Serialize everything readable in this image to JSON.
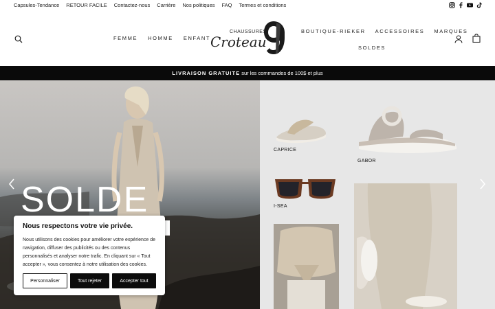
{
  "topbar": {
    "links": [
      "Capsules-Tendance",
      "RETOUR FACILE",
      "Contactez-nous",
      "Carrière",
      "Nos politiques",
      "FAQ",
      "Termes et conditions"
    ],
    "social_icons": [
      "instagram-icon",
      "facebook-icon",
      "youtube-icon",
      "tiktok-icon"
    ]
  },
  "header": {
    "nav_left": [
      "FEMME",
      "HOMME",
      "ENFANT"
    ],
    "nav_right_row1": [
      "BOUTIQUE-RIEKER",
      "ACCESSOIRES",
      "MARQUES"
    ],
    "nav_right_row2": [
      "SOLDES"
    ],
    "logo": {
      "small_text": "CHAUSSURES",
      "script_text": "Croteau"
    },
    "icons": [
      "search-icon",
      "user-icon",
      "cart-icon"
    ]
  },
  "announcement": {
    "bold": "LIVRAISON GRATUITE",
    "rest": " sur les commandes de 100$ et plus"
  },
  "hero": {
    "headline": "SOLDE",
    "products": [
      "CAPRICE",
      "GABOR",
      "I-SEA"
    ]
  },
  "cookie": {
    "title": "Nous respectons votre vie privée.",
    "body": "Nous utilisons des cookies pour améliorer votre expérience de navigation, diffuser des publicités ou des contenus personnalisés et analyser notre trafic. En cliquant sur « Tout accepter », vous consentez à notre utilisation des cookies.",
    "customize": "Personnaliser",
    "reject": "Tout rejeter",
    "accept": "Accepter tout"
  },
  "colors": {
    "announcement_bg": "#0a0a0a",
    "button_dark": "#0c0c0c",
    "hero_right_bg": "#e7e7e7"
  }
}
